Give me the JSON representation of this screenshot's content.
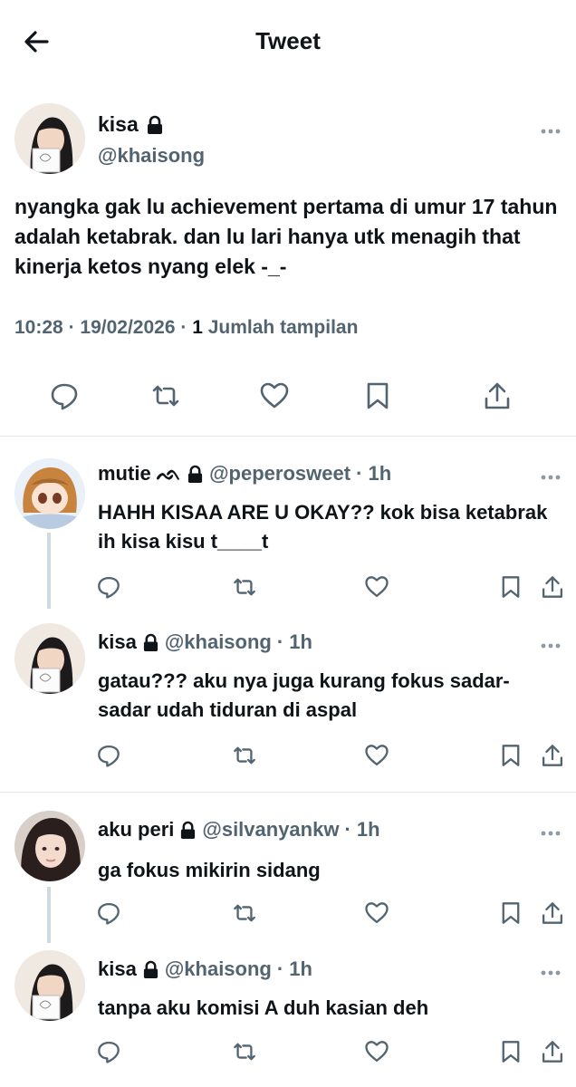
{
  "header": {
    "title": "Tweet",
    "back_icon": "arrow-left-icon"
  },
  "main_tweet": {
    "name": "kisa",
    "handle": "@khaisong",
    "text": "nyangka gak lu achievement pertama di umur 17 tahun adalah ketabrak. dan lu lari hanya utk menagih that kinerja ketos nyang elek -_-",
    "time": "10:28",
    "date": "19/02/2026",
    "views_count": "1",
    "views_label": "Jumlah tampilan",
    "separator": "·"
  },
  "replies": [
    {
      "name": "mutie",
      "name_suffix": "ᨒ",
      "handle": "@peperosweet",
      "time": "· 1h",
      "text": "HAHH KISAA ARE U OKAY?? kok bisa ketabrak ih kisa kisu t____t"
    },
    {
      "name": "kisa",
      "name_suffix": "",
      "handle": "@khaisong",
      "time": "· 1h",
      "text": "gatau??? aku nya juga kurang fokus sadar-sadar udah tiduran di aspal"
    },
    {
      "name": "aku peri",
      "name_suffix": "",
      "handle": "@silvanyankw",
      "time": "· 1h",
      "text": "ga fokus mikirin sidang"
    },
    {
      "name": "kisa",
      "name_suffix": "",
      "handle": "@khaisong",
      "time": "· 1h",
      "text": "tanpa aku komisi A duh kasian deh"
    }
  ],
  "colors": {
    "text": "#0f1419",
    "secondary": "#536471",
    "divider": "#e4e8eb",
    "thread_line": "#cfd9de"
  }
}
